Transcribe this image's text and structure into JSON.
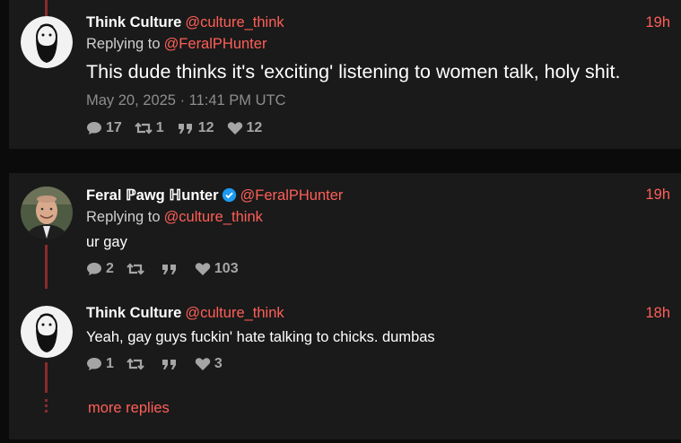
{
  "tweets": [
    {
      "name": "Think Culture",
      "handle": "@culture_think",
      "time": "19h",
      "replying_prefix": "Replying to",
      "replying_handle": "@FeralPHunter",
      "text": "This dude thinks it's 'exciting' listening to women talk, holy shit.",
      "date": "May 20, 2025 · 11:41 PM UTC",
      "stats": {
        "replies": "17",
        "retweets": "1",
        "quotes": "12",
        "likes": "12"
      }
    },
    {
      "name": "Feral ℙawg ℍunter",
      "handle": "@FeralPHunter",
      "verified": true,
      "time": "19h",
      "replying_prefix": "Replying to",
      "replying_handle": "@culture_think",
      "text": "ur gay",
      "stats": {
        "replies": "2",
        "retweets": "",
        "quotes": "",
        "likes": "103"
      }
    },
    {
      "name": "Think Culture",
      "handle": "@culture_think",
      "time": "18h",
      "text": "Yeah, gay guys fuckin' hate talking to chicks. dumbas",
      "stats": {
        "replies": "1",
        "retweets": "",
        "quotes": "",
        "likes": "3"
      }
    }
  ],
  "more_replies": "more replies",
  "icons": [
    "comment-icon",
    "retweet-icon",
    "quote-icon",
    "heart-icon",
    "verified-icon"
  ],
  "colors": {
    "accent": "#ff5f57",
    "background": "#0b0b0b",
    "card": "#1a1a1a",
    "thread_line": "#8b2a2a"
  }
}
